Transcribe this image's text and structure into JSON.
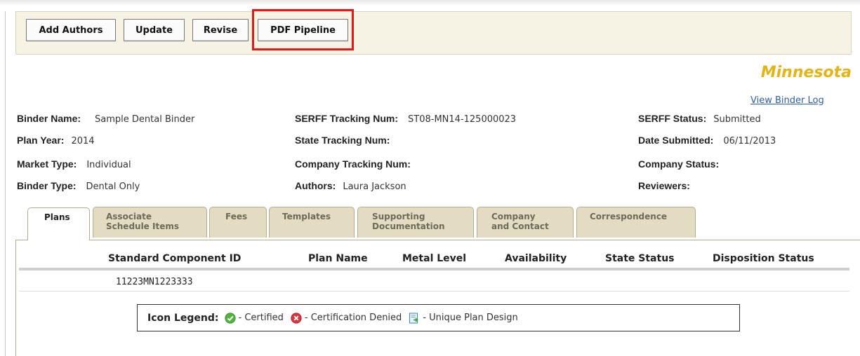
{
  "toolbar": {
    "buttons": [
      "Add Authors",
      "Update",
      "Revise",
      "PDF Pipeline"
    ],
    "highlight_color": "#e31a1a"
  },
  "header": {
    "state": "Minnesota",
    "view_binder_log": "View Binder Log"
  },
  "binder": {
    "binder_name": {
      "label": "Binder Name:",
      "value": "Sample Dental Binder"
    },
    "plan_year": {
      "label": "Plan Year:",
      "value": "2014"
    },
    "market_type": {
      "label": "Market Type:",
      "value": "Individual"
    },
    "binder_type": {
      "label": "Binder Type:",
      "value": "Dental Only"
    },
    "serff_tracking": {
      "label": "SERFF Tracking Num:",
      "value": "ST08-MN14-125000023"
    },
    "state_tracking": {
      "label": "State Tracking Num:",
      "value": ""
    },
    "company_tracking": {
      "label": "Company Tracking Num:",
      "value": ""
    },
    "authors": {
      "label": "Authors:",
      "value": "Laura Jackson"
    },
    "serff_status": {
      "label": "SERFF Status:",
      "value": "Submitted"
    },
    "date_submitted": {
      "label": "Date Submitted:",
      "value": "06/11/2013"
    },
    "company_status": {
      "label": "Company Status:",
      "value": ""
    },
    "reviewers": {
      "label": "Reviewers:",
      "value": ""
    }
  },
  "tabs": [
    {
      "line1": "Plans",
      "line2": "",
      "active": true
    },
    {
      "line1": "Associate",
      "line2": "Schedule Items",
      "active": false
    },
    {
      "line1": "Fees",
      "line2": "",
      "active": false
    },
    {
      "line1": "Templates",
      "line2": "",
      "active": false
    },
    {
      "line1": "Supporting",
      "line2": "Documentation",
      "active": false
    },
    {
      "line1": "Company",
      "line2": "and Contact",
      "active": false
    },
    {
      "line1": "Correspondence",
      "line2": "",
      "active": false
    }
  ],
  "plans_table": {
    "columns": [
      "Standard Component ID",
      "Plan Name",
      "Metal Level",
      "Availability",
      "State Status",
      "Disposition Status"
    ],
    "rows": [
      [
        "11223MN1223333",
        "",
        "",
        "",
        "",
        ""
      ]
    ]
  },
  "legend": {
    "title": "Icon Legend:",
    "items": [
      {
        "icon": "certified-icon",
        "text": "- Certified",
        "color": "#52b33f"
      },
      {
        "icon": "denied-icon",
        "text": "- Certification Denied",
        "color": "#d9363e"
      },
      {
        "icon": "unique-plan-icon",
        "text": "- Unique Plan Design",
        "color": "#3d86c6"
      }
    ]
  }
}
